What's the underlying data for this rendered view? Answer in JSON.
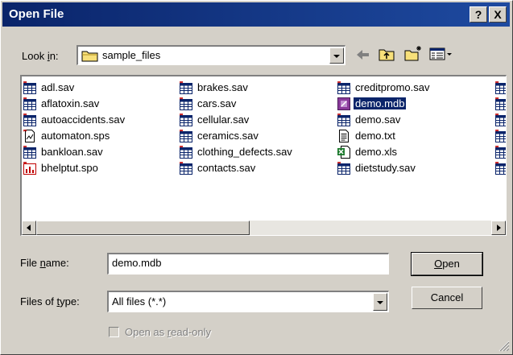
{
  "window": {
    "title": "Open File",
    "help_button": "?",
    "close_button": "X"
  },
  "lookin": {
    "label_pre": "Look ",
    "label_key": "i",
    "label_post": "n:",
    "value": "sample_files"
  },
  "files": {
    "col1": [
      {
        "name": "adl.sav",
        "icon": "sav-icon"
      },
      {
        "name": "aflatoxin.sav",
        "icon": "sav-icon"
      },
      {
        "name": "autoaccidents.sav",
        "icon": "sav-icon"
      },
      {
        "name": "automaton.sps",
        "icon": "sps-icon"
      },
      {
        "name": "bankloan.sav",
        "icon": "sav-icon"
      },
      {
        "name": "bhelptut.spo",
        "icon": "spo-icon"
      }
    ],
    "col2": [
      {
        "name": "brakes.sav",
        "icon": "sav-icon"
      },
      {
        "name": "cars.sav",
        "icon": "sav-icon"
      },
      {
        "name": "cellular.sav",
        "icon": "sav-icon"
      },
      {
        "name": "ceramics.sav",
        "icon": "sav-icon"
      },
      {
        "name": "clothing_defects.sav",
        "icon": "sav-icon"
      },
      {
        "name": "contacts.sav",
        "icon": "sav-icon"
      }
    ],
    "col3": [
      {
        "name": "creditpromo.sav",
        "icon": "sav-icon"
      },
      {
        "name": "demo.mdb",
        "icon": "mdb-icon"
      },
      {
        "name": "demo.sav",
        "icon": "sav-icon"
      },
      {
        "name": "demo.txt",
        "icon": "txt-icon"
      },
      {
        "name": "demo.xls",
        "icon": "xls-icon"
      },
      {
        "name": "dietstudy.sav",
        "icon": "sav-icon"
      }
    ],
    "selected": "demo.mdb"
  },
  "filename": {
    "label_pre": "File ",
    "label_key": "n",
    "label_post": "ame:",
    "value": "demo.mdb"
  },
  "filetype": {
    "label_pre": "Files of ",
    "label_key": "t",
    "label_post": "ype:",
    "value": "All files (*.*)"
  },
  "buttons": {
    "open_key": "O",
    "open_rest": "pen",
    "cancel": "Cancel"
  },
  "readonly": {
    "label_pre": "Open as ",
    "label_key": "r",
    "label_post": "ead-only"
  },
  "colors": {
    "title_bar": "#0a246a",
    "selection": "#0a246a",
    "face": "#d4d0c8"
  }
}
